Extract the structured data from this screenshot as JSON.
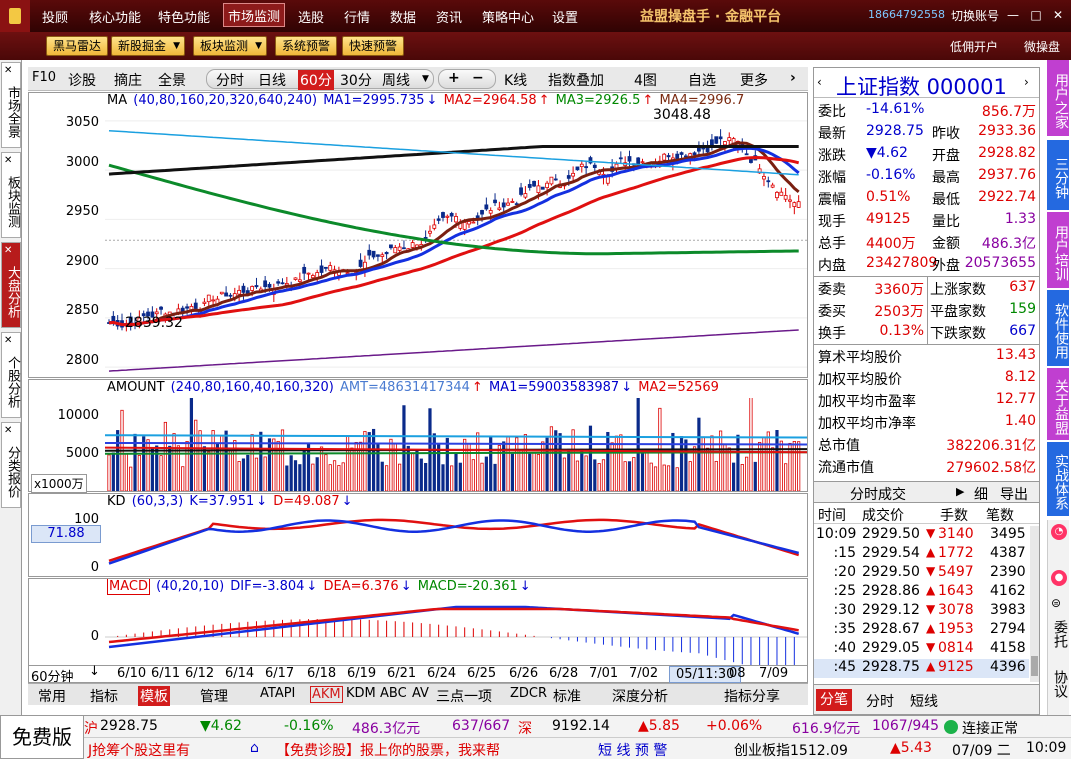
{
  "menu": {
    "items": [
      "投顾",
      "核心功能",
      "特色功能",
      "市场监测",
      "选股",
      "行情",
      "数据",
      "资讯",
      "策略中心",
      "设置"
    ],
    "active": "市场监测",
    "brand": "益盟操盘手 · 金融平台",
    "phone": "18664792558",
    "switch_account": "切换账号"
  },
  "toolbar": {
    "buttons": [
      "黑马雷达",
      "新股掘金",
      "板块监测",
      "系统预警",
      "快速预警"
    ],
    "right_links": [
      "低佣开户",
      "微操盘"
    ]
  },
  "left_tabs": [
    "市场全景",
    "板块监测",
    "大盘分析",
    "个股分析",
    "分类报价"
  ],
  "chart_toolbar": {
    "items": [
      "F10",
      "诊股",
      "摘庄",
      "全景",
      "分时",
      "日线",
      "60分",
      "30分",
      "周线",
      "K线",
      "指数叠加",
      "4图",
      "自选",
      "更多"
    ]
  },
  "main_panel": {
    "label": "MA",
    "params": "(40,80,160,20,320,640,240)",
    "ma1": "MA1=2995.735",
    "ma2": "MA2=2964.58",
    "ma3": "MA3=2926.5",
    "ma4": "MA4=2996.7",
    "high_label": "3048.48",
    "low_label": "2839.32",
    "yticks": [
      "3050",
      "3000",
      "2950",
      "2900",
      "2850",
      "2800"
    ]
  },
  "amount_panel": {
    "label": "AMOUNT",
    "params": "(240,80,160,40,160,320)",
    "amt": "AMT=48631417344",
    "ma1": "MA1=59003583987",
    "ma2": "MA2=52569",
    "yticks": [
      "10000",
      "5000"
    ],
    "unit": "x1000万"
  },
  "kd_panel": {
    "label": "KD",
    "params": "(60,3,3)",
    "k": "K=37.951",
    "d": "D=49.087",
    "yticks": [
      "100",
      "0"
    ],
    "marker": "71.88"
  },
  "macd_panel": {
    "label": "MACD",
    "params": "(40,20,10)",
    "dif": "DIF=-3.804",
    "dea": "DEA=6.376",
    "macd": "MACD=-20.361",
    "yticks": [
      "0"
    ]
  },
  "x_axis": {
    "period": "60分钟",
    "labels": [
      "6/10",
      "6/11",
      "6/12",
      "6/14",
      "6/17",
      "6/18",
      "6/19",
      "6/21",
      "6/24",
      "6/25",
      "6/26",
      "6/28",
      "7/01",
      "7/02",
      "05/11:30",
      "08",
      "7/09"
    ]
  },
  "bottom_tabs": [
    "常用",
    "指标",
    "模板",
    "管理",
    "ATAPI",
    "AKM",
    "KDM",
    "ABC",
    "AV",
    "三点一项",
    "ZDCR",
    "标准",
    "深度分析",
    "指标分享"
  ],
  "quote": {
    "title": "上证指数 000001",
    "rows": [
      {
        "l": "委比",
        "v": "-14.61%",
        "l2": "",
        "v2": "856.7万"
      },
      {
        "l": "最新",
        "v": "2928.75",
        "l2": "昨收",
        "v2": "2933.36"
      },
      {
        "l": "涨跌",
        "v": "▼4.62",
        "l2": "开盘",
        "v2": "2928.82"
      },
      {
        "l": "涨幅",
        "v": "-0.16%",
        "l2": "最高",
        "v2": "2937.76"
      },
      {
        "l": "震幅",
        "v": "0.51%",
        "l2": "最低",
        "v2": "2922.74"
      },
      {
        "l": "现手",
        "v": "49125",
        "l2": "量比",
        "v2": "1.33"
      },
      {
        "l": "总手",
        "v": "4400万",
        "l2": "金额",
        "v2": "486.3亿"
      },
      {
        "l": "内盘",
        "v": "23427809",
        "l2": "外盘",
        "v2": "20573655"
      }
    ],
    "rows2": [
      {
        "l": "委卖",
        "v": "3360万",
        "l2": "上涨家数",
        "v2": "637"
      },
      {
        "l": "委买",
        "v": "2503万",
        "l2": "平盘家数",
        "v2": "159"
      },
      {
        "l": "换手",
        "v": "0.13%",
        "l2": "下跌家数",
        "v2": "667"
      }
    ],
    "rows3": [
      {
        "l": "算术平均股价",
        "v": "13.43"
      },
      {
        "l": "加权平均股价",
        "v": "8.12"
      },
      {
        "l": "加权平均市盈率",
        "v": "12.77"
      },
      {
        "l": "加权平均市净率",
        "v": "1.40"
      },
      {
        "l": "总市值",
        "v": "382206.31亿"
      },
      {
        "l": "流通市值",
        "v": "279602.58亿"
      }
    ],
    "trades_title": "分时成交",
    "trades_btn1": "细",
    "trades_btn2": "导出",
    "trade_headers": [
      "时间",
      "成交价",
      "手数",
      "笔数"
    ],
    "trades": [
      {
        "t": "10:09",
        "p": "2929.50",
        "q": "3140",
        "n": "3495"
      },
      {
        "t": ":15",
        "p": "2929.54",
        "q": "1772",
        "n": "4387"
      },
      {
        "t": ":20",
        "p": "2929.50",
        "q": "5497",
        "n": "2390"
      },
      {
        "t": ":25",
        "p": "2928.86",
        "q": "1643",
        "n": "4162"
      },
      {
        "t": ":30",
        "p": "2929.12",
        "q": "3078",
        "n": "3983"
      },
      {
        "t": ":35",
        "p": "2928.67",
        "q": "1953",
        "n": "2794"
      },
      {
        "t": ":40",
        "p": "2929.05",
        "q": "0814",
        "n": "4158"
      },
      {
        "t": ":45",
        "p": "2928.75",
        "q": "9125",
        "n": "4396"
      }
    ],
    "bottom_tabs": [
      "分笔",
      "分时",
      "短线"
    ]
  },
  "right_tabs": [
    "用户之家",
    "三分钟",
    "用户培训",
    "软件使用",
    "关于益盟",
    "实战体系",
    "委托",
    "协议"
  ],
  "status": {
    "free": "免费版",
    "sh_label": "沪",
    "sh_price": "2928.75",
    "sh_change": "▼4.62",
    "sh_pct": "-0.16%",
    "sh_amount": "486.3亿元",
    "sh_count": "637/667",
    "sz_label": "深",
    "sz_price": "9192.14",
    "sz_change": "▲5.85",
    "sz_pct": "+0.06%",
    "sz_amount": "616.9亿元",
    "sz_count": "1067/945",
    "conn": "连接正常",
    "ticker": "J抢筹个股这里有",
    "promo": "【免费诊股】报上你的股票，我来帮",
    "alert": "短 线 预 警",
    "cyb": "创业板指1512.09",
    "cyb_change": "▲5.43",
    "date": "07/09 二",
    "time": "10:09"
  }
}
